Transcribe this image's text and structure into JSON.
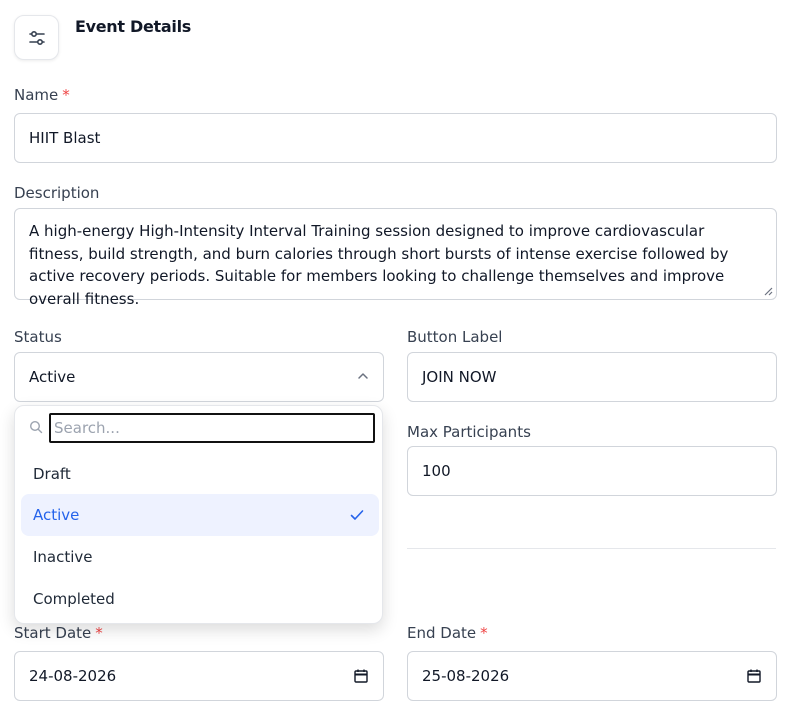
{
  "header": {
    "title": "Event Details",
    "icon": "sliders-icon"
  },
  "name": {
    "label": "Name",
    "required": "*",
    "value": "HIIT Blast"
  },
  "description": {
    "label": "Description",
    "value": "A high-energy High-Intensity Interval Training session designed to improve cardiovascular fitness, build strength, and burn calories through short bursts of intense exercise followed by active recovery periods. Suitable for members looking to challenge themselves and improve overall fitness."
  },
  "status": {
    "label": "Status",
    "value": "Active",
    "dropdown": {
      "search_placeholder": "Search...",
      "options": [
        {
          "label": "Draft"
        },
        {
          "label": "Active"
        },
        {
          "label": "Inactive"
        },
        {
          "label": "Completed"
        }
      ]
    }
  },
  "button_label": {
    "label": "Button Label",
    "value": "JOIN NOW"
  },
  "max_participants": {
    "label": "Max Participants",
    "value": "100"
  },
  "start_date": {
    "label": "Start Date",
    "required": "*",
    "value": "24-08-2026"
  },
  "end_date": {
    "label": "End Date",
    "required": "*",
    "value": "25-08-2026"
  },
  "colors": {
    "accent": "#2563eb",
    "selected_bg": "#eef2ff",
    "required": "#ef4444",
    "border": "#d1d5db"
  }
}
